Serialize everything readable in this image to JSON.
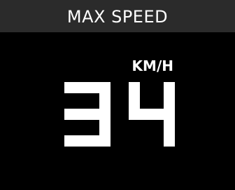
{
  "header": {
    "title": "MAX SPEED"
  },
  "readout": {
    "value": "34",
    "unit": "KM/H"
  },
  "colors": {
    "background": "#000000",
    "header_bar": "#2b2b2b",
    "text": "#ffffff"
  }
}
